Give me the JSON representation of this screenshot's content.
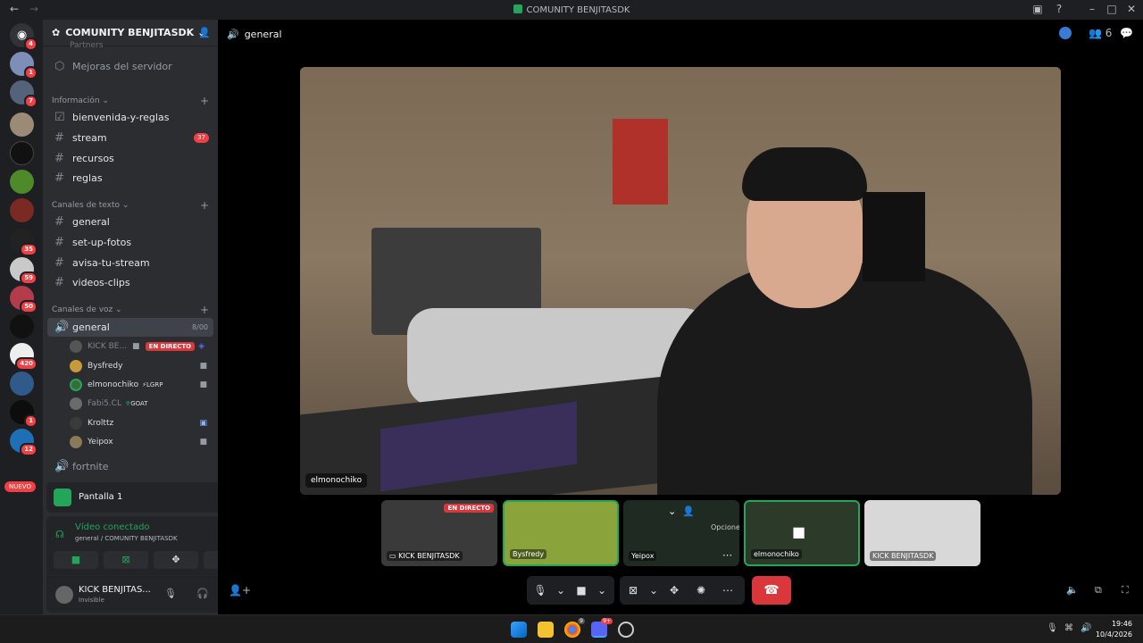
{
  "window": {
    "title": "COMUNITY BENJITASDK"
  },
  "servers": {
    "badges": [
      "4",
      "1",
      "7",
      "35",
      "59",
      "50",
      "420",
      "1",
      "12"
    ],
    "nuevo_label": "NUEVO"
  },
  "sidebar": {
    "guild_name": "COMUNITY BENJITASDK",
    "partial_top": "Partners",
    "boost": "Mejoras del servidor",
    "categories": {
      "info": "Información",
      "text": "Canales de texto",
      "voice": "Canales de voz"
    },
    "info_channels": [
      {
        "name": "bienvenida-y-reglas"
      },
      {
        "name": "stream",
        "mentions": "37"
      },
      {
        "name": "recursos"
      },
      {
        "name": "reglas"
      }
    ],
    "text_channels": [
      "general",
      "set-up-fotos",
      "avisa-tu-stream",
      "videos-clips"
    ],
    "voice": {
      "active_channel": "general",
      "capacity": "8/00",
      "users": [
        {
          "name": "KICK BE...",
          "live": "EN DIRECTO"
        },
        {
          "name": "Bysfredy"
        },
        {
          "name": "elmonochiko",
          "tag": "LGRP"
        },
        {
          "name": "Fabi5.CL",
          "tag": "GOAT"
        },
        {
          "name": "Krolttz"
        },
        {
          "name": "Yeipox"
        }
      ],
      "other_channel": "fortnite"
    },
    "screen_panel": {
      "title": "Pantalla 1"
    },
    "connection": {
      "status": "Vídeo conectado",
      "location": "general / COMUNITY BENJITASDK"
    },
    "user": {
      "name": "KICK BENJITAS...",
      "status": "Invisible"
    }
  },
  "main": {
    "channel_name": "general",
    "member_count": "6",
    "focused_user": "elmonochiko",
    "tiles": [
      {
        "name": "KICK BENJITASDK",
        "live": "EN DIRECTO"
      },
      {
        "name": "Bysfredy"
      },
      {
        "name": "Yeipox",
        "hover_label": "Opciones"
      },
      {
        "name": "elmonochiko"
      },
      {
        "name": "KICK BENJITASDK"
      }
    ]
  },
  "taskbar": {
    "time": "19:46",
    "date": "10/4/2026",
    "chrome_badge": "9",
    "discord_badge": "9+"
  },
  "colors": {
    "accent_green": "#23a55a",
    "danger": "#da373c",
    "sidebar": "#2b2d31",
    "rail": "#1e1f22"
  }
}
